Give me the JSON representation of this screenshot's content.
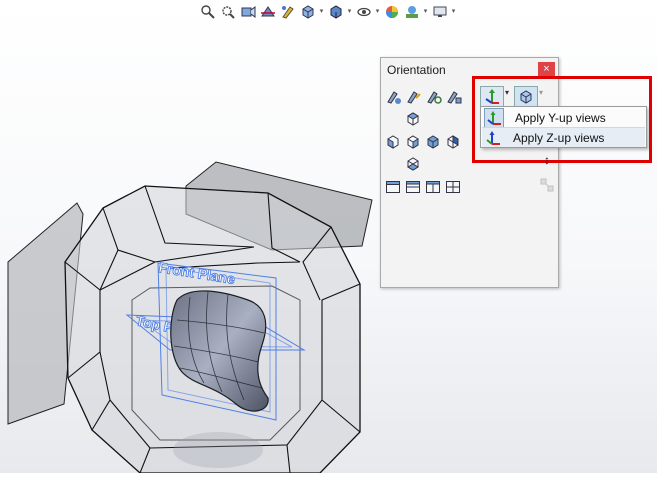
{
  "orientation_dialog": {
    "title": "Orientation",
    "close_glyph": "×",
    "toolbar_icons": [
      "new-view-icon",
      "update-standard-views-icon",
      "reset-standard-views-icon",
      "view-selector-icon"
    ],
    "up_axis_icon": "y-up-axis-icon",
    "view_cube_icon": "view-cube-icon"
  },
  "up_axis_dropdown": {
    "items": [
      {
        "label": "Apply Y-up views",
        "icon": "y-up-axis-icon",
        "selected": true
      },
      {
        "label": "Apply Z-up views",
        "icon": "z-up-axis-icon",
        "selected": false
      }
    ]
  },
  "model": {
    "plane_labels": [
      "Front Plane",
      "Top Plane"
    ]
  },
  "colors": {
    "highlight": "#e00000",
    "plane_blue": "#4f7fe6",
    "close_red": "#e04343"
  }
}
